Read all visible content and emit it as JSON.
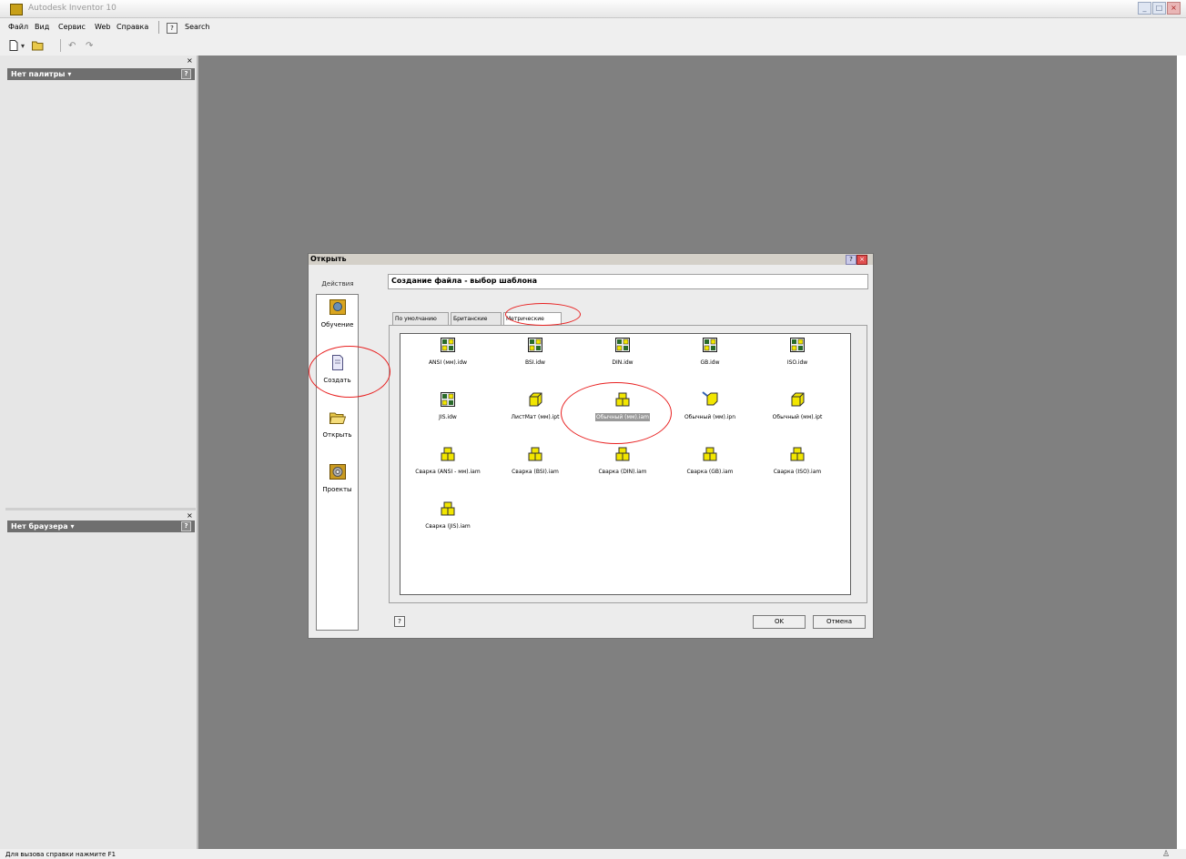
{
  "window": {
    "title": "Autodesk Inventor 10",
    "minimize": "_",
    "maximize": "□",
    "close": "×"
  },
  "menu": {
    "items": [
      "Файл",
      "Вид",
      "Сервис",
      "Web",
      "Справка"
    ],
    "help_icon": "?",
    "search_label": "Search"
  },
  "toolbar": {
    "icons": [
      "new-document-icon",
      "dropdown-arrow-icon",
      "open-folder-icon",
      "undo-icon",
      "redo-icon"
    ]
  },
  "panels": {
    "palette": {
      "title": "Нет палитры ▾",
      "close": "×",
      "help": "?"
    },
    "browser": {
      "title": "Нет браузера ▾",
      "close": "×",
      "help": "?"
    }
  },
  "status": {
    "text": "Для вызова справки нажмите F1"
  },
  "dialog": {
    "title": "Открыть",
    "help": "?",
    "close": "×",
    "actions_header": "Действия",
    "actions": [
      {
        "label": "Обучение",
        "icon": "tutorial-icon"
      },
      {
        "label": "Создать",
        "icon": "new-file-icon"
      },
      {
        "label": "Открыть",
        "icon": "open-folder-icon"
      },
      {
        "label": "Проекты",
        "icon": "projects-icon"
      }
    ],
    "heading": "Создание файла - выбор шаблона",
    "tabs": [
      "По умолчанию",
      "Британские",
      "Метрические"
    ],
    "active_tab": "Метрические",
    "files": [
      {
        "label": "ANSI (мм).idw",
        "icon": "drawing-icon"
      },
      {
        "label": "BSI.idw",
        "icon": "drawing-icon"
      },
      {
        "label": "DIN.idw",
        "icon": "drawing-icon"
      },
      {
        "label": "GB.idw",
        "icon": "drawing-icon"
      },
      {
        "label": "ISO.idw",
        "icon": "drawing-icon"
      },
      {
        "label": "JIS.idw",
        "icon": "drawing-icon"
      },
      {
        "label": "ЛистМат (мм).ipt",
        "icon": "part-icon"
      },
      {
        "label": "Обычный (мм).iam",
        "icon": "assembly-icon"
      },
      {
        "label": "Обычный (мм).ipn",
        "icon": "presentation-icon"
      },
      {
        "label": "Обычный (мм).ipt",
        "icon": "part-icon"
      },
      {
        "label": "Сварка (ANSI - мм).iam",
        "icon": "assembly-icon"
      },
      {
        "label": "Сварка (BSI).iam",
        "icon": "assembly-icon"
      },
      {
        "label": "Сварка (DIN).iam",
        "icon": "assembly-icon"
      },
      {
        "label": "Сварка (GB).iam",
        "icon": "assembly-icon"
      },
      {
        "label": "Сварка (ISO).iam",
        "icon": "assembly-icon"
      },
      {
        "label": "Сварка (JIS).iam",
        "icon": "assembly-icon"
      }
    ],
    "selected_file": "Обычный (мм).iam",
    "footer_help": "?",
    "ok_label": "OK",
    "cancel_label": "Отмена"
  },
  "colors": {
    "workspace": "#808080",
    "panel_header": "#6f6f6f",
    "annotation": "#e82020",
    "icon_yellow": "#f2e600"
  }
}
